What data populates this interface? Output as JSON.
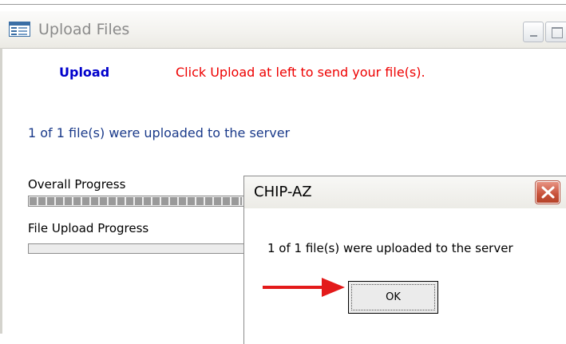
{
  "window": {
    "title": "Upload Files",
    "icon": "form-window-icon"
  },
  "main": {
    "upload_link": "Upload",
    "instructions": "Click Upload at left to send your file(s).",
    "status": "1 of 1 file(s) were uploaded to the server",
    "overall_progress": {
      "label": "Overall Progress",
      "value_fraction": 0.93
    },
    "file_progress": {
      "label": "File Upload Progress",
      "value_fraction": 0.0
    }
  },
  "dialog": {
    "title": "CHIP-AZ",
    "message": "1 of 1 file(s) were uploaded to the server",
    "ok_label": "OK",
    "close_icon": "close-icon"
  },
  "colors": {
    "upload_link": "#0000cc",
    "instructions": "#ee0000",
    "status": "#1a3a8a",
    "annotation_arrow": "#e31a1a",
    "dialog_close": "#c8513a"
  }
}
